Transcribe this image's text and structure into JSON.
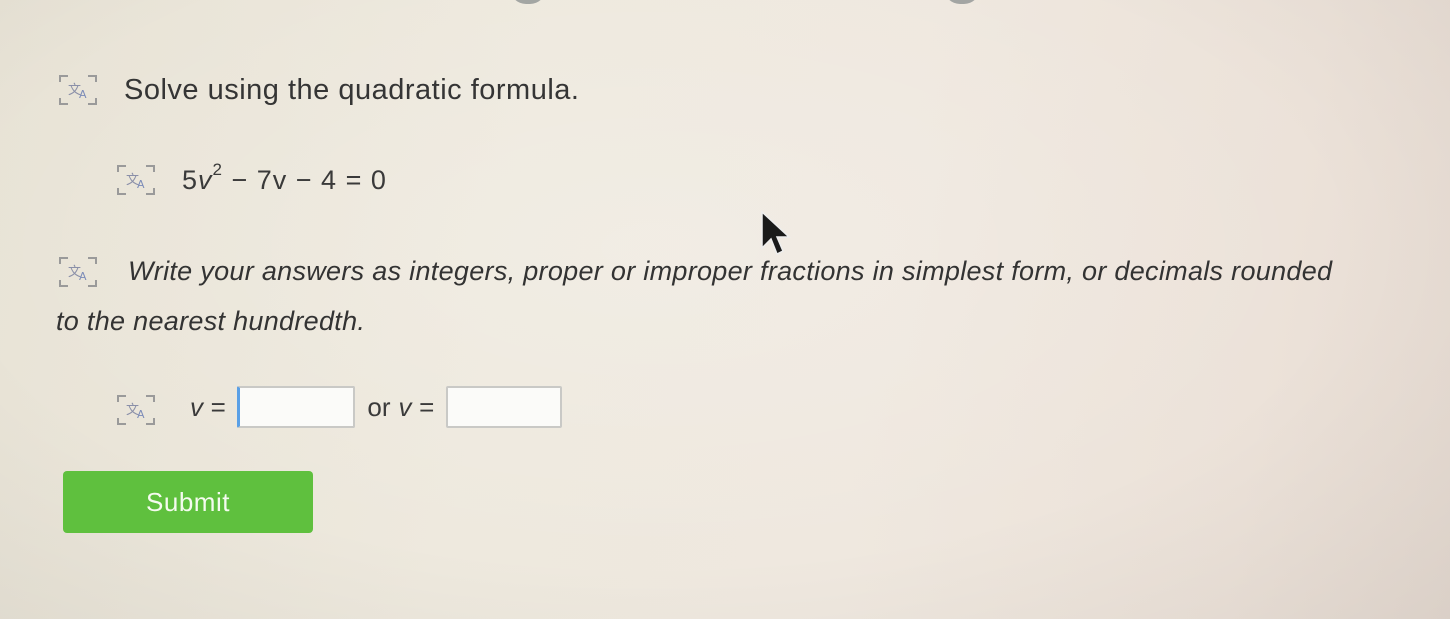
{
  "question": {
    "instruction": "Solve using the quadratic formula.",
    "equation": {
      "coef_a": "5",
      "variable": "v",
      "exponent": "2",
      "rest": " − 7v − 4 = 0"
    },
    "directions": "Write your answers as integers, proper or improper fractions in simplest form, or decimals rounded to the nearest hundredth."
  },
  "answer": {
    "var_label_1": "v =",
    "or_label": "or",
    "var_label_2": "v =",
    "input_1_value": "",
    "input_2_value": ""
  },
  "submit": {
    "label": "Submit"
  },
  "icons": {
    "translate": "translate-icon",
    "cursor": "mouse-pointer-icon"
  },
  "colors": {
    "submit_bg": "#5fc03e",
    "active_input_border": "#5aa0e6"
  }
}
